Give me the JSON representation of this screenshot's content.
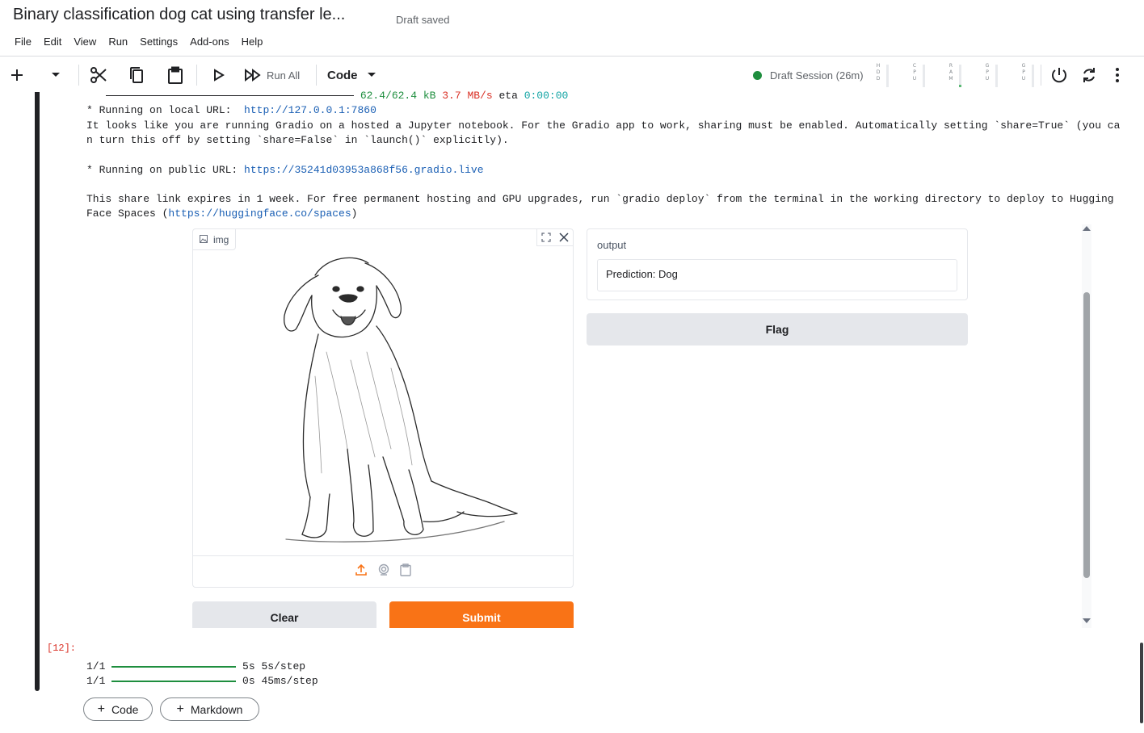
{
  "header": {
    "title": "Binary classification dog cat using transfer le...",
    "status": "Draft saved",
    "menu": [
      "File",
      "Edit",
      "View",
      "Run",
      "Settings",
      "Add-ons",
      "Help"
    ]
  },
  "toolbar": {
    "run_all_label": "Run All",
    "cell_type": "Code",
    "session": "Draft Session (26m)",
    "meters": [
      {
        "label": "HDD",
        "level": 0.0
      },
      {
        "label": "CPU",
        "level": 0.0
      },
      {
        "label": "RAM",
        "level": 0.1
      },
      {
        "label": "GPU",
        "level": 0.0
      },
      {
        "label": "GPU",
        "level": 0.0
      }
    ]
  },
  "output": {
    "download": {
      "size": "62.4/62.4 kB",
      "speed": "3.7 MB/s",
      "eta_label": "eta",
      "eta": "0:00:00"
    },
    "local_prefix": "* Running on local URL:  ",
    "local_url": "http://127.0.0.1:7860",
    "notice_line1": "It looks like you are running Gradio on a hosted a Jupyter notebook. For the Gradio app to work, sharing must be enabled. Automatically setting `share=True` (you ca",
    "notice_line2": "n turn this off by setting `share=False` in `launch()` explicitly).",
    "public_prefix": "* Running on public URL: ",
    "public_url": "https://35241d03953a868f56.gradio.live",
    "share_line1": "This share link expires in 1 week. For free permanent hosting and GPU upgrades, run `gradio deploy` from the terminal in the working directory to deploy to Hugging",
    "share_line2_prefix": "Face Spaces (",
    "share_url": "https://huggingface.co/spaces",
    "share_line2_suffix": ")"
  },
  "gradio": {
    "image_label": "img",
    "output_label": "output",
    "prediction": "Prediction: Dog",
    "flag_label": "Flag",
    "clear_label": "Clear",
    "submit_label": "Submit"
  },
  "cell12": {
    "exec_count": "[12]:",
    "lines": [
      {
        "step": "1/1",
        "time": "5s",
        "rate": "5s/step"
      },
      {
        "step": "1/1",
        "time": "0s",
        "rate": "45ms/step"
      }
    ]
  },
  "add_cell": {
    "code_label": "Code",
    "markdown_label": "Markdown"
  },
  "colors": {
    "accent": "#f97316",
    "progress": "#1e8e3e",
    "session": "#1e8e3e",
    "link": "#1a5fb4"
  }
}
